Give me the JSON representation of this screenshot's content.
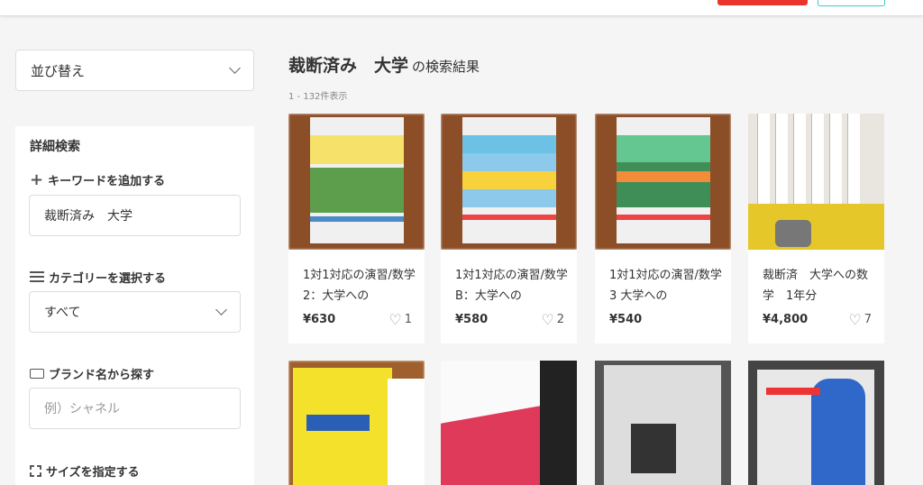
{
  "sort": {
    "label": "並び替え"
  },
  "search": {
    "title": "詳細検索",
    "keyword_label": "キーワードを追加する",
    "keyword_value": "裁断済み　大学",
    "category_label": "カテゴリーを選択する",
    "category_value": "すべて",
    "brand_label": "ブランド名から探す",
    "brand_placeholder": "例）シャネル",
    "size_label": "サイズを指定する"
  },
  "results": {
    "query": "裁断済み　大学",
    "suffix": "の検索結果",
    "count": "1 - 132件表示"
  },
  "items": [
    {
      "name": "1対1対応の演習/数学2：大学への",
      "price": "¥630",
      "likes": "1"
    },
    {
      "name": "1対1対応の演習/数学B：大学への",
      "price": "¥580",
      "likes": "2"
    },
    {
      "name": "1対1対応の演習/数学3 大学への",
      "price": "¥540",
      "likes": ""
    },
    {
      "name": "裁断済　大学への数学　1年分",
      "price": "¥4,800",
      "likes": "7"
    }
  ],
  "colors": {
    "sell_button": "#ea352d",
    "outline_button": "#3ccace"
  }
}
